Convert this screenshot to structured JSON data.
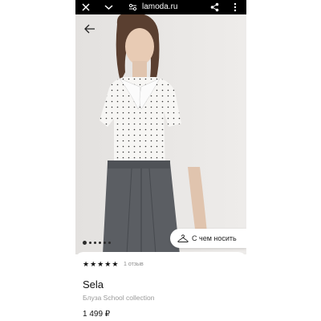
{
  "browser": {
    "url": "lamoda.ru",
    "close_icon": "close-icon",
    "chevron_icon": "chevron-down-icon",
    "settings_icon": "tune-icon",
    "share_icon": "share-icon",
    "menu_icon": "more-vertical-icon"
  },
  "gallery": {
    "back_icon": "arrow-left-icon",
    "image_count": 6,
    "active_index": 0
  },
  "outfit_button": {
    "label": "С чем носить",
    "icon": "hanger-icon"
  },
  "product": {
    "rating": 5,
    "reviews": "1 отзыв",
    "brand": "Sela",
    "subtitle": "Блуза School collection",
    "price": "1 499 ₽"
  }
}
